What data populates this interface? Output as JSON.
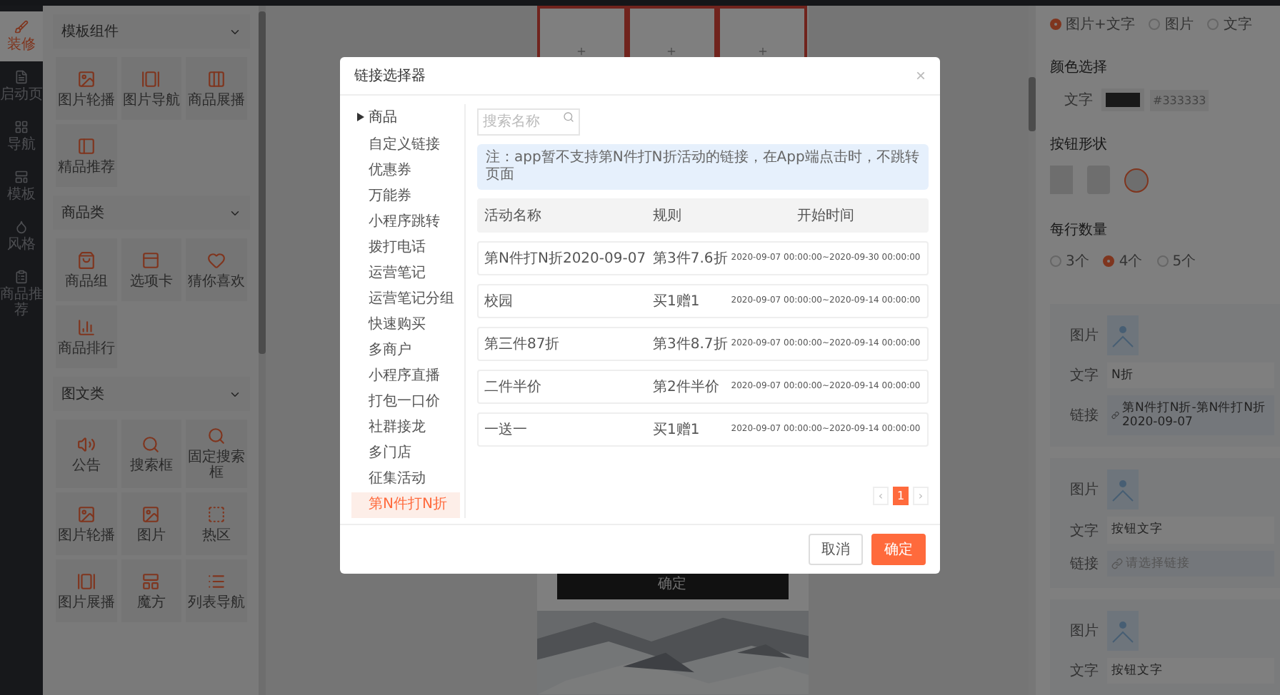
{
  "nav": [
    {
      "label": "装修",
      "selected": true
    },
    {
      "label": "启动页",
      "selected": false
    },
    {
      "label": "导航",
      "selected": false
    },
    {
      "label": "模板",
      "selected": false
    },
    {
      "label": "风格",
      "selected": false
    },
    {
      "label": "商品推荐",
      "selected": false
    }
  ],
  "widget_groups": [
    {
      "title": "模板组件",
      "items": [
        "图片轮播",
        "图片导航",
        "商品展播",
        "精品推荐"
      ]
    },
    {
      "title": "商品类",
      "items": [
        "商品组",
        "选项卡",
        "猜你喜欢",
        "商品排行"
      ]
    },
    {
      "title": "图文类",
      "items": [
        "公告",
        "搜索框",
        "固定搜索框",
        "图片轮播",
        "图片",
        "热区",
        "图片展播",
        "魔方",
        "列表导航"
      ]
    }
  ],
  "preview": {
    "button": "确定"
  },
  "settings": {
    "styles": [
      {
        "label": "图片+文字",
        "selected": true
      },
      {
        "label": "图片",
        "selected": false
      },
      {
        "label": "文字",
        "selected": false
      }
    ],
    "color_title": "颜色选择",
    "color_label": "文字",
    "color_value": "#333333",
    "shape_title": "按钮形状",
    "shapes": [
      {
        "kind": "square",
        "selected": false
      },
      {
        "kind": "rounded",
        "selected": false
      },
      {
        "kind": "circle",
        "selected": true
      }
    ],
    "count_title": "每行数量",
    "counts": [
      {
        "label": "3个",
        "selected": false
      },
      {
        "label": "4个",
        "selected": true
      },
      {
        "label": "5个",
        "selected": false
      }
    ],
    "cards": [
      {
        "image_label": "图片",
        "text_label": "文字",
        "text": "N折",
        "link_label": "链接",
        "link": "第N件打N折-第N件打N折2020-09-07"
      },
      {
        "image_label": "图片",
        "text_label": "文字",
        "text": "按钮文字",
        "link_label": "链接",
        "link_placeholder": "请选择链接"
      },
      {
        "image_label": "图片",
        "text_label": "文字",
        "text": "按钮文字"
      }
    ]
  },
  "modal": {
    "title": "链接选择器",
    "close": "×",
    "tree": {
      "label": "商品",
      "expanded": false
    },
    "types": [
      {
        "label": "自定义链接",
        "selected": false
      },
      {
        "label": "优惠券",
        "selected": false
      },
      {
        "label": "万能券",
        "selected": false
      },
      {
        "label": "小程序跳转",
        "selected": false
      },
      {
        "label": "拨打电话",
        "selected": false
      },
      {
        "label": "运营笔记",
        "selected": false
      },
      {
        "label": "运营笔记分组",
        "selected": false
      },
      {
        "label": "快速购买",
        "selected": false
      },
      {
        "label": "多商户",
        "selected": false
      },
      {
        "label": "小程序直播",
        "selected": false
      },
      {
        "label": "打包一口价",
        "selected": false
      },
      {
        "label": "社群接龙",
        "selected": false
      },
      {
        "label": "多门店",
        "selected": false
      },
      {
        "label": "征集活动",
        "selected": false
      },
      {
        "label": "第N件打N折",
        "selected": true
      }
    ],
    "search": {
      "placeholder": "搜索名称"
    },
    "notice": "注：app暂不支持第N件打N折活动的链接，在App端点击时，不跳转页面",
    "columns": [
      "活动名称",
      "规则",
      "开始时间"
    ],
    "rows": [
      [
        "第N件打N折2020-09-07",
        "第3件7.6折",
        "2020-09-07 00:00:00~2020-09-30 00:00:00"
      ],
      [
        "校园",
        "买1赠1",
        "2020-09-07 00:00:00~2020-09-14 00:00:00"
      ],
      [
        "第三件87折",
        "第3件8.7折",
        "2020-09-07 00:00:00~2020-09-14 00:00:00"
      ],
      [
        "二件半价",
        "第2件半价",
        "2020-09-07 00:00:00~2020-09-14 00:00:00"
      ],
      [
        "一送一",
        "买1赠1",
        "2020-09-07 00:00:00~2020-09-14 00:00:00"
      ]
    ],
    "pagination": {
      "prev": "‹",
      "pages": [
        {
          "label": "1",
          "selected": true
        }
      ],
      "next": "›"
    },
    "buttons": {
      "cancel": "取消",
      "ok": "确定"
    }
  }
}
